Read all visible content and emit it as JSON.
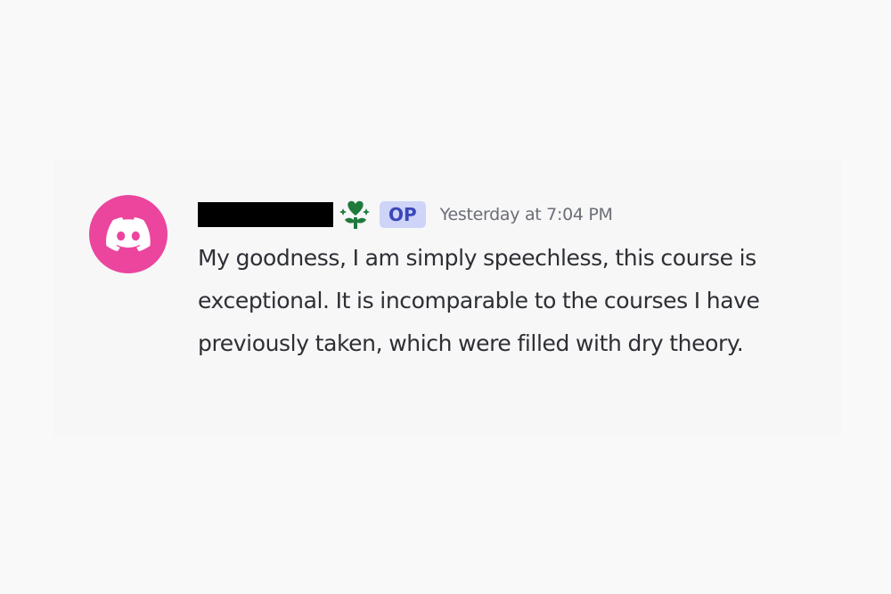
{
  "message": {
    "author": {
      "avatar_icon": "discord-logo-icon",
      "avatar_color": "#eb459e",
      "name_redacted": true,
      "role_icon": "heart-sparkle-icon",
      "role_icon_color": "#1f7a3c",
      "badge_label": "OP",
      "badge_color": "#cdd4f8"
    },
    "timestamp": "Yesterday at 7:04 PM",
    "text": "My goodness, I am simply speechless, this course is exceptional. It is incomparable to the courses I have previously taken, which were filled with dry theory."
  }
}
